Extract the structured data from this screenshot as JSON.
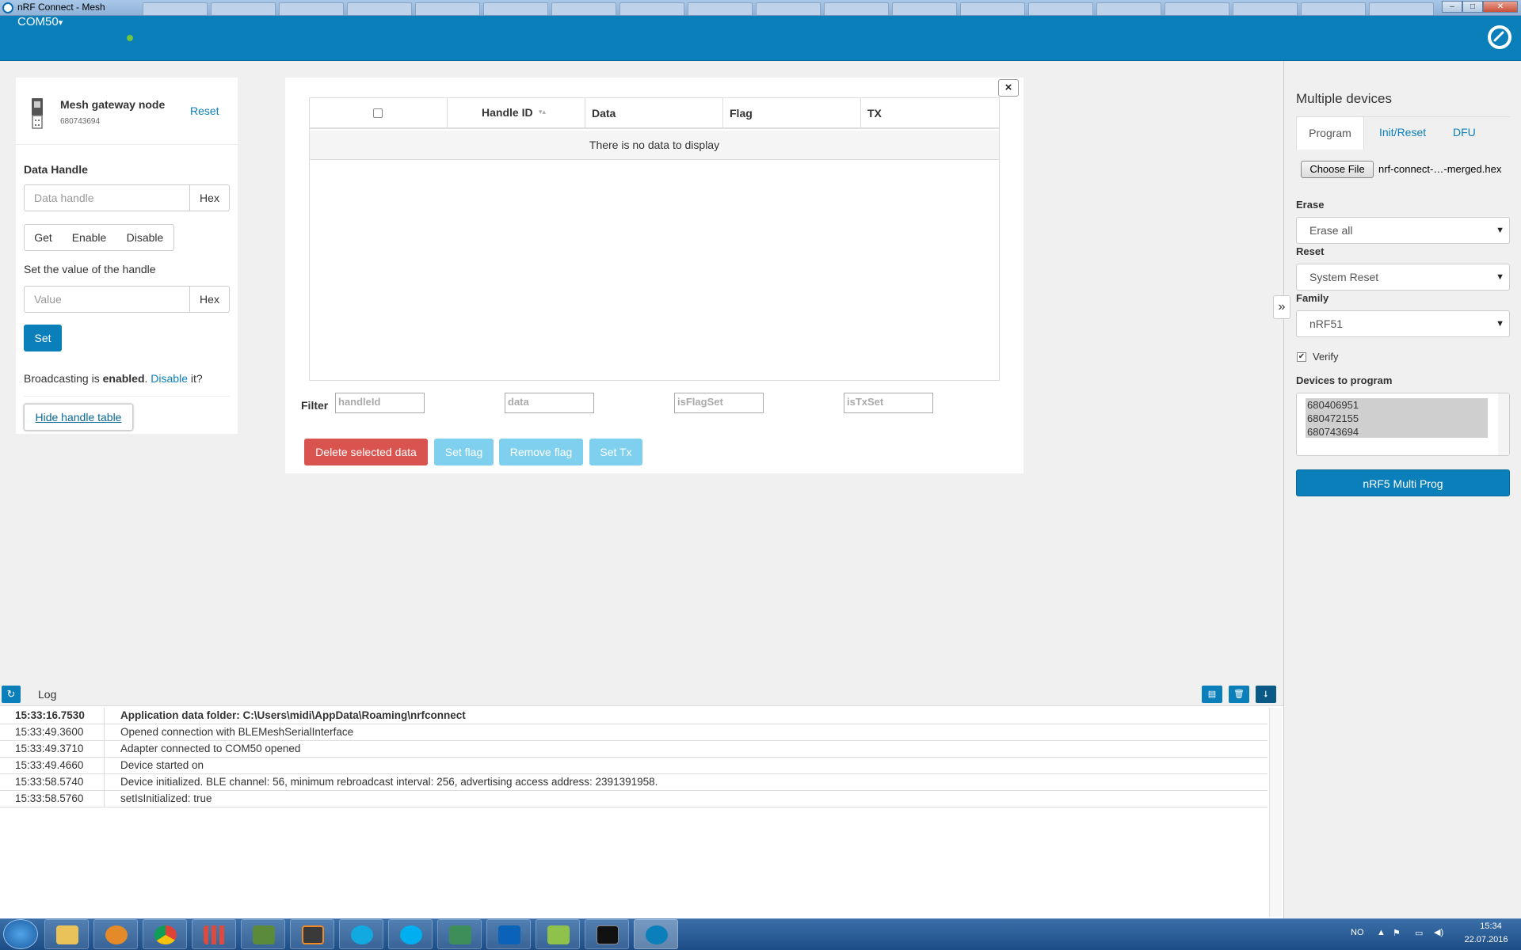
{
  "window": {
    "title": "nRF Connect - Mesh",
    "minimize": "–",
    "maximize": "□",
    "close": "✕"
  },
  "topbar": {
    "port": "COM50",
    "port_caret": "▾",
    "status_color": "#71c43d"
  },
  "device": {
    "name": "Mesh gateway node",
    "serial": "680743694",
    "reset": "Reset"
  },
  "data_handle": {
    "heading": "Data Handle",
    "placeholder": "Data handle",
    "hex": "Hex",
    "get": "Get",
    "enable": "Enable",
    "disable": "Disable",
    "set_value_label": "Set the value of the handle",
    "value_placeholder": "Value",
    "value_hex": "Hex",
    "set": "Set"
  },
  "broadcast": {
    "prefix": "Broadcasting is ",
    "state": "enabled",
    "period": ". ",
    "link": "Disable",
    "suffix": " it?"
  },
  "hide_table": "Hide handle table",
  "table": {
    "close": "×",
    "columns": [
      "Handle ID",
      "Data",
      "Flag",
      "TX"
    ],
    "sort_icon": "▾▴",
    "empty": "There is no data to display",
    "filter_label": "Filter",
    "filters": [
      "handleId",
      "data",
      "isFlagSet",
      "isTxSet"
    ]
  },
  "actions": {
    "delete": "Delete selected data",
    "set_flag": "Set flag",
    "remove_flag": "Remove flag",
    "set_tx": "Set Tx"
  },
  "right": {
    "title": "Multiple devices",
    "tabs": [
      "Program",
      "Init/Reset",
      "DFU"
    ],
    "choose_file": "Choose File",
    "file_name": "nrf-connect-…-merged.hex",
    "erase_label": "Erase",
    "erase_value": "Erase all",
    "reset_label": "Reset",
    "reset_value": "System Reset",
    "family_label": "Family",
    "family_value": "nRF51",
    "verify": "Verify",
    "verify_checked": true,
    "devices_label": "Devices to program",
    "devices": [
      "680406951",
      "680472155",
      "680743694"
    ],
    "program_button": "nRF5 Multi Prog",
    "collapse": "»"
  },
  "log": {
    "title": "Log",
    "entries": [
      {
        "time": "15:33:16.7530",
        "msg": "Application data folder: C:\\Users\\midi\\AppData\\Roaming\\nrfconnect"
      },
      {
        "time": "15:33:49.3600",
        "msg": "Opened connection with BLEMeshSerialInterface"
      },
      {
        "time": "15:33:49.3710",
        "msg": "Adapter connected to COM50 opened"
      },
      {
        "time": "15:33:49.4660",
        "msg": "Device started on"
      },
      {
        "time": "15:33:58.5740",
        "msg": "Device initialized. BLE channel: 56, minimum rebroadcast interval: 256, advertising access address: 2391391958."
      },
      {
        "time": "15:33:58.5760",
        "msg": "setIsInitialized: true"
      }
    ]
  },
  "taskbar": {
    "lang": "NO",
    "time": "15:34",
    "date": "22.07.2016"
  },
  "colors": {
    "brand": "#0a7fba",
    "danger": "#d9534f",
    "info_disabled": "#7fd0ef"
  }
}
